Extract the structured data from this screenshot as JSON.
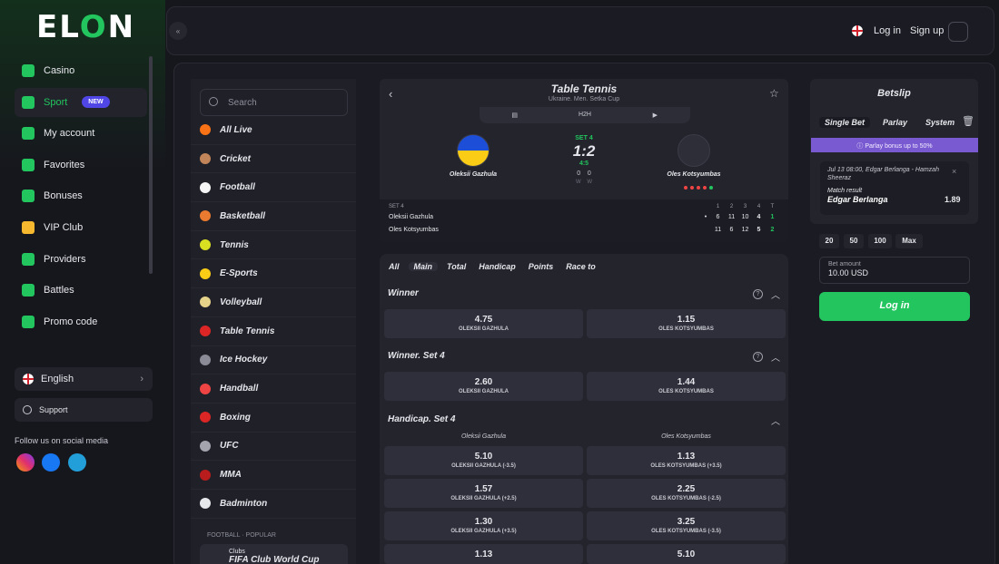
{
  "brand": {
    "logo": "ELON"
  },
  "nav": {
    "items": [
      {
        "label": "Casino",
        "icon": "casino-icon"
      },
      {
        "label": "Sport",
        "icon": "sport-icon",
        "badge": "NEW"
      },
      {
        "label": "My account",
        "icon": "account-icon"
      },
      {
        "label": "Favorites",
        "icon": "heart-icon"
      },
      {
        "label": "Bonuses",
        "icon": "gift-icon"
      },
      {
        "label": "VIP Club",
        "icon": "crown-icon"
      },
      {
        "label": "Providers",
        "icon": "grid-icon"
      },
      {
        "label": "Battles",
        "icon": "trophy-icon"
      },
      {
        "label": "Promo code",
        "icon": "ticket-icon"
      }
    ],
    "language": "English",
    "support": "Support",
    "social_label": "Follow us on social media"
  },
  "topbar": {
    "login": "Log in",
    "signup": "Sign up"
  },
  "search": {
    "placeholder": "Search"
  },
  "sports": [
    "All Live",
    "Cricket",
    "Football",
    "Basketball",
    "Tennis",
    "E-Sports",
    "Volleyball",
    "Table Tennis",
    "Ice Hockey",
    "Handball",
    "Boxing",
    "UFC",
    "MMA",
    "Badminton"
  ],
  "popular": {
    "label": "FOOTBALL · POPULAR",
    "card_small": "Clubs",
    "card_title": "FIFA Club World Cup"
  },
  "match": {
    "title": "Table Tennis",
    "subtitle": "Ukraine. Men. Setka Cup",
    "tabs": [
      "",
      "H2H",
      ""
    ],
    "player1": "Oleksii Gazhula",
    "player2": "Oles Kotsyumbas",
    "set_label": "SET 4",
    "score": "1:2",
    "game_score": "4:5",
    "points_p1": "0",
    "points_p2": "0",
    "w1": "W",
    "w2": "W",
    "table": {
      "set_label": "SET 4",
      "headers": [
        "1",
        "2",
        "3",
        "4",
        "T"
      ],
      "rows": [
        {
          "name": "Oleksii Gazhula",
          "vals": [
            "6",
            "11",
            "10",
            "4",
            "1"
          ]
        },
        {
          "name": "Oles Kotsyumbas",
          "vals": [
            "11",
            "6",
            "12",
            "5",
            "2"
          ]
        }
      ]
    }
  },
  "markets": {
    "tabs": [
      "All",
      "Main",
      "Total",
      "Handicap",
      "Points",
      "Race to"
    ],
    "winner": {
      "title": "Winner",
      "odds": [
        {
          "v": "4.75",
          "l": "OLEKSII GAZHULA"
        },
        {
          "v": "1.15",
          "l": "OLES KOTSYUMBAS"
        }
      ]
    },
    "winner_set": {
      "title": "Winner. Set 4",
      "odds": [
        {
          "v": "2.60",
          "l": "OLEKSII GAZHULA"
        },
        {
          "v": "1.44",
          "l": "OLES KOTSYUMBAS"
        }
      ]
    },
    "handicap": {
      "title": "Handicap. Set 4",
      "col1": "Oleksii Gazhula",
      "col2": "Oles Kotsyumbas",
      "rows": [
        [
          {
            "v": "5.10",
            "l": "OLEKSII GAZHULA (-3.5)"
          },
          {
            "v": "1.13",
            "l": "OLES KOTSYUMBAS (+3.5)"
          }
        ],
        [
          {
            "v": "1.57",
            "l": "OLEKSII GAZHULA (+2.5)"
          },
          {
            "v": "2.25",
            "l": "OLES KOTSYUMBAS (-2.5)"
          }
        ],
        [
          {
            "v": "1.30",
            "l": "OLEKSII GAZHULA (+3.5)"
          },
          {
            "v": "3.25",
            "l": "OLES KOTSYUMBAS (-3.5)"
          }
        ],
        [
          {
            "v": "1.13",
            "l": ""
          },
          {
            "v": "5.10",
            "l": ""
          }
        ]
      ]
    }
  },
  "betslip": {
    "title": "Betslip",
    "tabs": [
      "Single Bet",
      "Parlay",
      "System"
    ],
    "parlay_banner": "Parlay bonus up to 50%",
    "item_event": "Jul 13 08:00, Edgar Berlanga - Hamzah Sheeraz",
    "item_market": "Match result",
    "item_pick": "Edgar Berlanga",
    "item_odd": "1.89",
    "quick": [
      "20",
      "50",
      "100",
      "Max"
    ],
    "amount_label": "Bet amount",
    "amount_value": "10.00 USD",
    "login": "Log in"
  }
}
